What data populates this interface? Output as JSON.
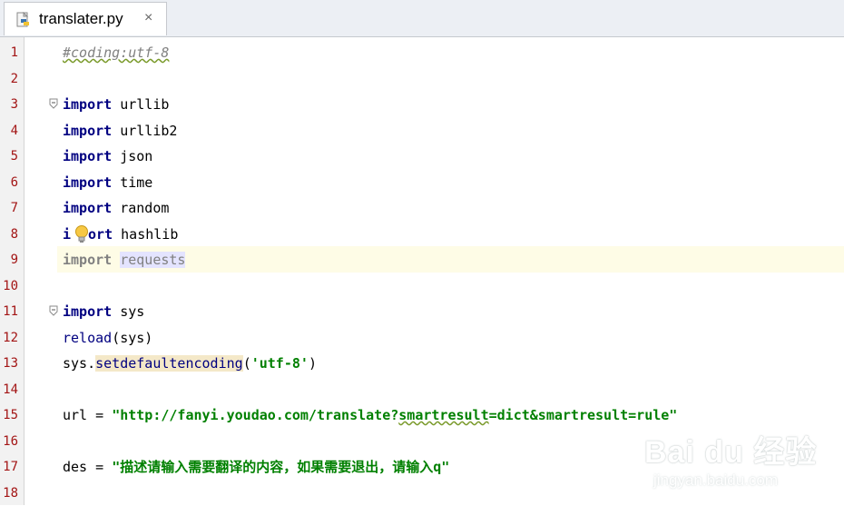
{
  "tab": {
    "filename": "translater.py",
    "close_glyph": "×",
    "icon": "python-file-icon"
  },
  "lines": [
    {
      "num": "1",
      "code": "#coding:utf-8"
    },
    {
      "num": "2",
      "code": ""
    },
    {
      "num": "3",
      "code": "import urllib"
    },
    {
      "num": "4",
      "code": "import urllib2"
    },
    {
      "num": "5",
      "code": "import json"
    },
    {
      "num": "6",
      "code": "import time"
    },
    {
      "num": "7",
      "code": "import random"
    },
    {
      "num": "8",
      "code": "import hashlib"
    },
    {
      "num": "9",
      "code": "import requests"
    },
    {
      "num": "10",
      "code": ""
    },
    {
      "num": "11",
      "code": "import sys"
    },
    {
      "num": "12",
      "code": "reload(sys)"
    },
    {
      "num": "13",
      "code": "sys.setdefaultencoding('utf-8')"
    },
    {
      "num": "14",
      "code": ""
    },
    {
      "num": "15",
      "code": "url = \"http://fanyi.youdao.com/translate?smartresult=dict&smartresult=rule\""
    },
    {
      "num": "16",
      "code": ""
    },
    {
      "num": "17",
      "code": "des = \"描述请输入需要翻译的内容，如果需要退出，请输入q\""
    },
    {
      "num": "18",
      "code": ""
    }
  ],
  "tokens": {
    "import": "import",
    "l1": "#coding:utf-8",
    "l3": " urllib",
    "l4": " urllib2",
    "l5": " json",
    "l6": " time",
    "l7": " random",
    "l8a": "i",
    "l8b": "ort",
    "l8c": " hashlib",
    "l9a": " ",
    "l9b": "requests",
    "l11": " sys",
    "l12a": "reload",
    "l12b": "(sys)",
    "l13a": "sys.",
    "l13b": "setdefaultencoding",
    "l13c": "(",
    "l13d": "'utf-8'",
    "l13e": ")",
    "l15a": "url = ",
    "l15b": "\"http://fanyi.youdao.com/translate?",
    "l15c": "smartresult",
    "l15d": "=dict&smartresult=rule\"",
    "l17a": "des = ",
    "l17b": "\"描述请输入需要翻译的内容，如果需要退出，请输入q\""
  },
  "highlighted_line": "9",
  "watermark": {
    "logo": "Bai du 经验",
    "sub": "jingyan.baidu.com"
  },
  "colors": {
    "keyword": "#000080",
    "string": "#008000",
    "comment": "#808080",
    "line_number": "#a31515",
    "current_line": "#fefce6"
  }
}
